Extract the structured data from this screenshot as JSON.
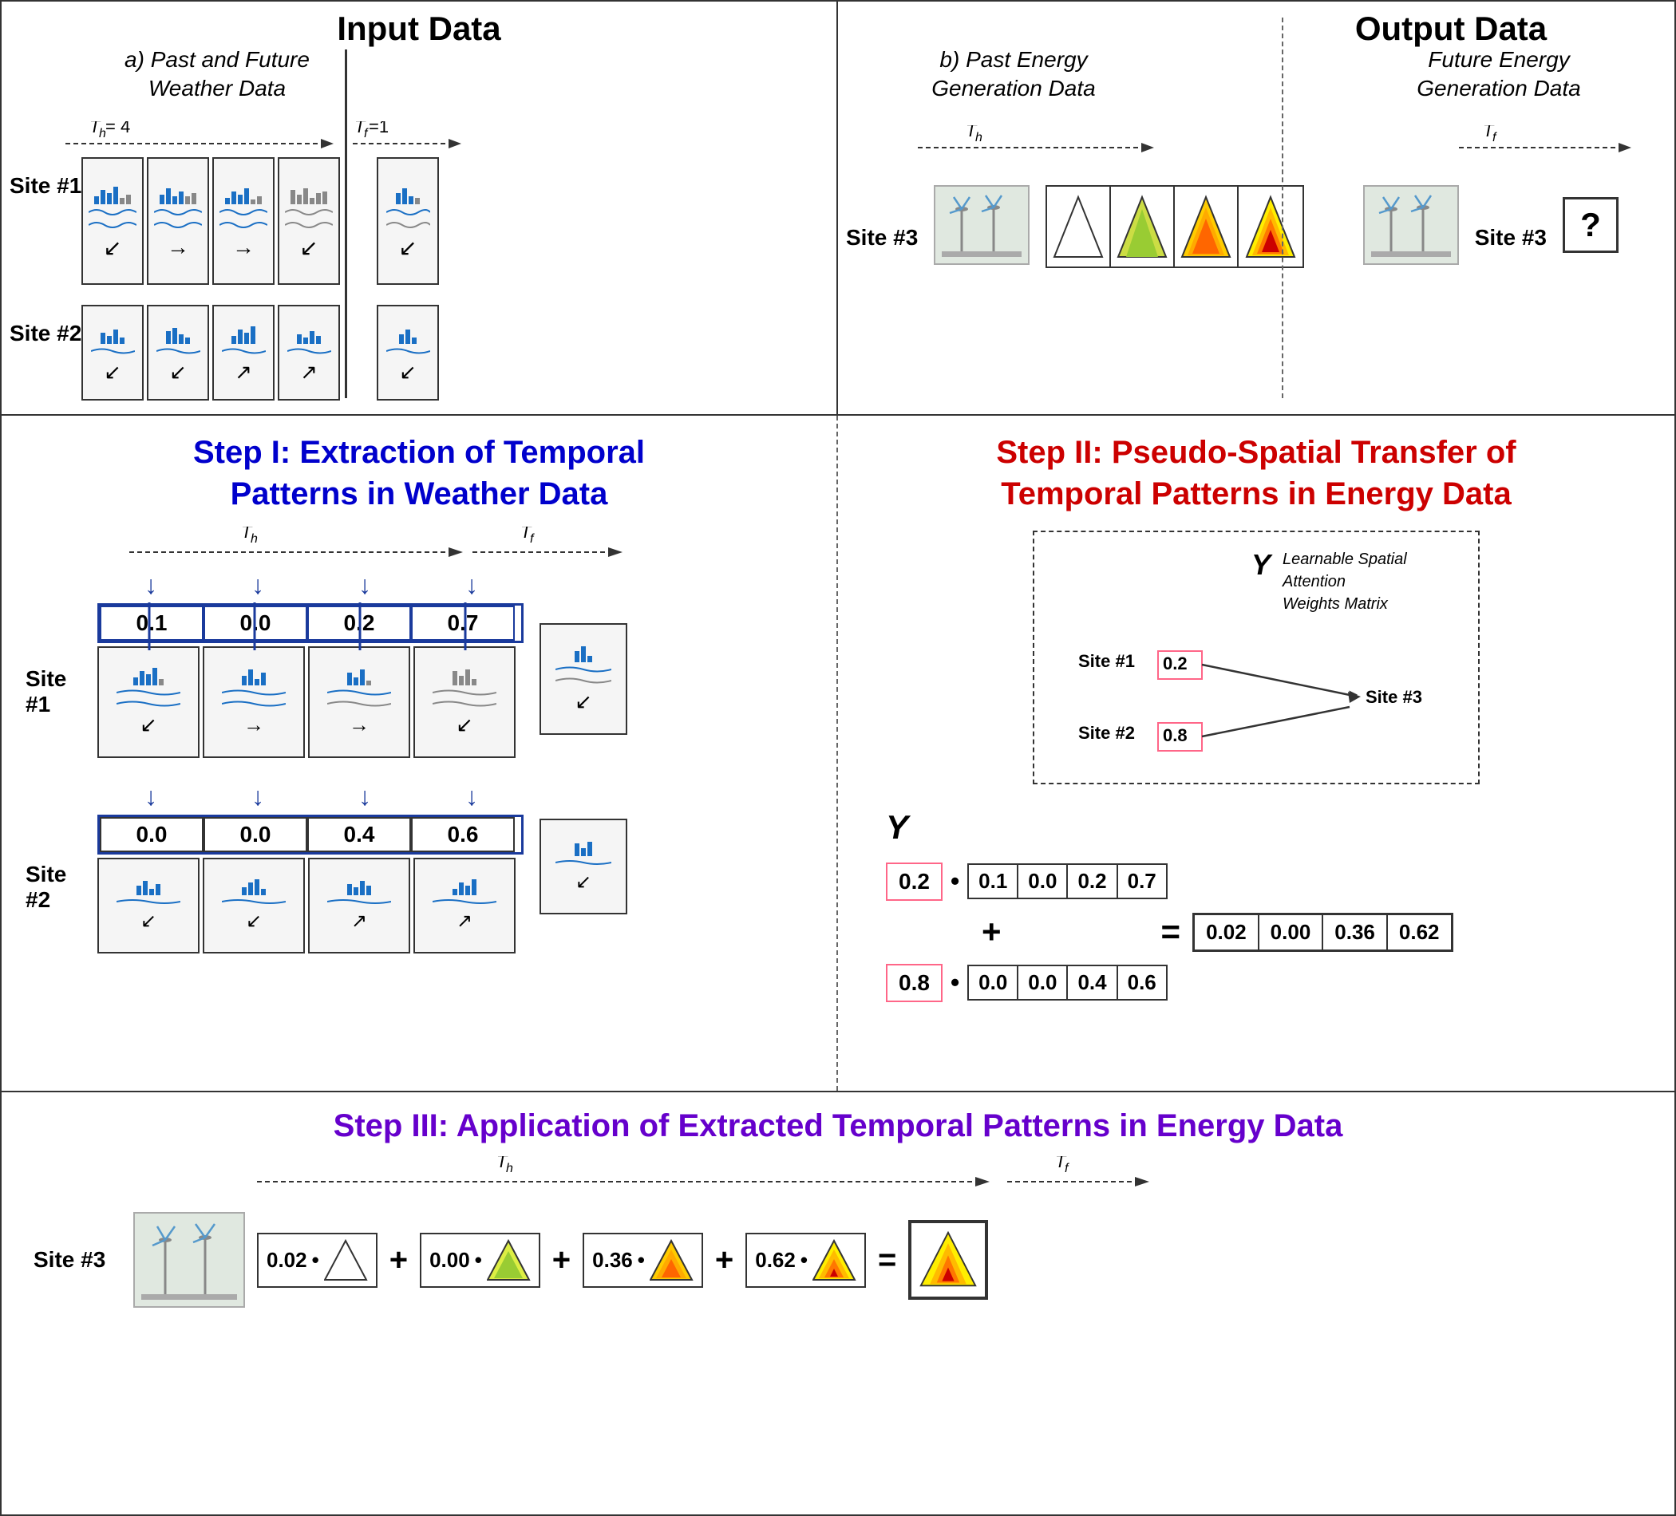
{
  "header": {
    "input_data": "Input Data",
    "output_data": "Output Data"
  },
  "top": {
    "section_a_label": "a) Past and Future\nWeather Data",
    "section_b_label": "b) Past Energy\nGeneration Data",
    "future_energy_label": "Future Energy\nGeneration Data",
    "th_eq4": "T",
    "th_eq4_sub": "h",
    "th_eq4_val": " = 4",
    "tf_eq1": "T",
    "tf_eq1_sub": "f",
    "tf_eq1_val": "=1",
    "th_label": "T",
    "th_label_sub": "h",
    "tf_label": "T",
    "tf_label_sub": "f",
    "site1": "Site #1",
    "site2": "Site #2",
    "site3_b": "Site #3",
    "site3_out": "Site #3"
  },
  "step1": {
    "title_line1": "Step I: Extraction of Temporal",
    "title_line2": "Patterns in Weather Data",
    "th_label": "T",
    "th_sub": "h",
    "tf_label": "T",
    "tf_sub": "f",
    "site1": "Site #1",
    "site2": "Site #2",
    "site1_values": [
      "0.1",
      "0.0",
      "0.2",
      "0.7"
    ],
    "site2_values": [
      "0.0",
      "0.0",
      "0.4",
      "0.6"
    ]
  },
  "step2": {
    "title_line1": "Step II: Pseudo-Spatial Transfer of",
    "title_line2": "Temporal Patterns in Energy Data",
    "y_label": "Y",
    "spatial_label": "Learnable Spatial Attention\nWeights Matrix",
    "site1_node": "Site #1",
    "site2_node": "Site #2",
    "site3_node": "Site #3",
    "weight_02": "0.2",
    "weight_08": "0.8",
    "matrix_y_label": "Y",
    "row1_vals": [
      "0.1",
      "0.0",
      "0.2",
      "0.7"
    ],
    "row2_vals": [
      "0.0",
      "0.0",
      "0.4",
      "0.6"
    ],
    "coeff_02": "0.2",
    "coeff_08": "0.8",
    "result_vals": [
      "0.02",
      "0.00",
      "0.36",
      "0.62"
    ],
    "bullet": "•",
    "plus": "+",
    "equals": "="
  },
  "step3": {
    "title": "Step III: Application of Extracted Temporal Patterns in Energy Data",
    "site3": "Site #3",
    "th_label": "T",
    "th_sub": "h",
    "tf_label": "T",
    "tf_sub": "f",
    "coefficients": [
      "0.02",
      "0.00",
      "0.36",
      "0.62"
    ],
    "bullet": "•",
    "plus": "+",
    "equals": "="
  }
}
